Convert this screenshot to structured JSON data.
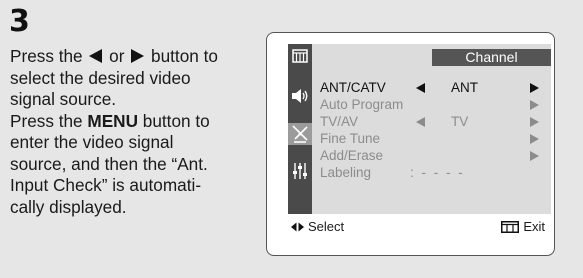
{
  "step": {
    "number": "3"
  },
  "instructions": {
    "line1_pre": "Press the",
    "line1_mid": "or",
    "line1_post": "button to",
    "line2": "select the desired video",
    "line3": "signal source.",
    "line4_pre": "Press the ",
    "line4_bold": "MENU",
    "line4_post": " button to",
    "line5": "enter the video signal",
    "line6": "source, and then the “Ant.",
    "line7": "Input Check” is automati-",
    "line8": "cally displayed."
  },
  "osd": {
    "header": "Channel",
    "sidebar_icons": [
      "picture-icon",
      "speaker-icon",
      "antenna-icon",
      "setup-sliders-icon"
    ],
    "rows": [
      {
        "label": "ANT/CATV",
        "value": "ANT",
        "dim": false
      },
      {
        "label": "Auto Program",
        "value": "",
        "dim": true
      },
      {
        "label": "TV/AV",
        "value": "TV",
        "dim": true
      },
      {
        "label": "Fine Tune",
        "value": "",
        "dim": true
      },
      {
        "label": "Add/Erase",
        "value": "",
        "dim": true
      },
      {
        "label": "Labeling",
        "value": ": - - - -",
        "dim": true
      }
    ],
    "footer": {
      "select_label": "Select",
      "exit_label": "Exit"
    }
  },
  "colors": {
    "background": "#e6e6e6",
    "menu_panel": "#dcdcdc",
    "sidebar": "#4a4a4a",
    "header": "#555555",
    "dim_text": "#8c8c8c"
  }
}
